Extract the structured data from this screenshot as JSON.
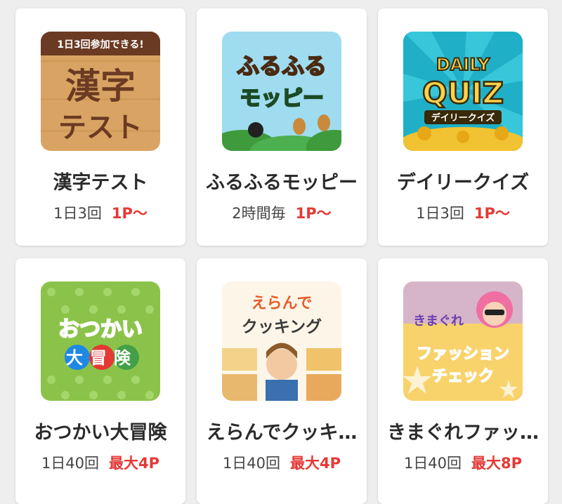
{
  "games": [
    {
      "title": "漢字テスト",
      "frequency": "1日3回",
      "points": "1P〜",
      "art": {
        "badge": "1日3回参加できる!",
        "line1": "漢字",
        "line2": "テスト"
      }
    },
    {
      "title": "ふるふるモッピー",
      "frequency": "2時間毎",
      "points": "1P〜",
      "art": {
        "line1": "ふるふる",
        "line2": "モッピー"
      }
    },
    {
      "title": "デイリークイズ",
      "frequency": "1日3回",
      "points": "1P〜",
      "art": {
        "line1": "DAILY",
        "line2": "QUIZ",
        "line3": "デイリークイズ"
      }
    },
    {
      "title": "おつかい大冒険",
      "frequency": "1日40回",
      "points": "最大4P",
      "art": {
        "line1": "おつかい",
        "line2": "大冒険"
      }
    },
    {
      "title": "えらんでクッキ…",
      "frequency": "1日40回",
      "points": "最大4P",
      "art": {
        "line1": "えらんで",
        "line2": "クッキング"
      }
    },
    {
      "title": "きまぐれファッ…",
      "frequency": "1日40回",
      "points": "最大8P",
      "art": {
        "line1": "きまぐれ",
        "line2": "ファッション",
        "line3": "チェック"
      }
    }
  ]
}
